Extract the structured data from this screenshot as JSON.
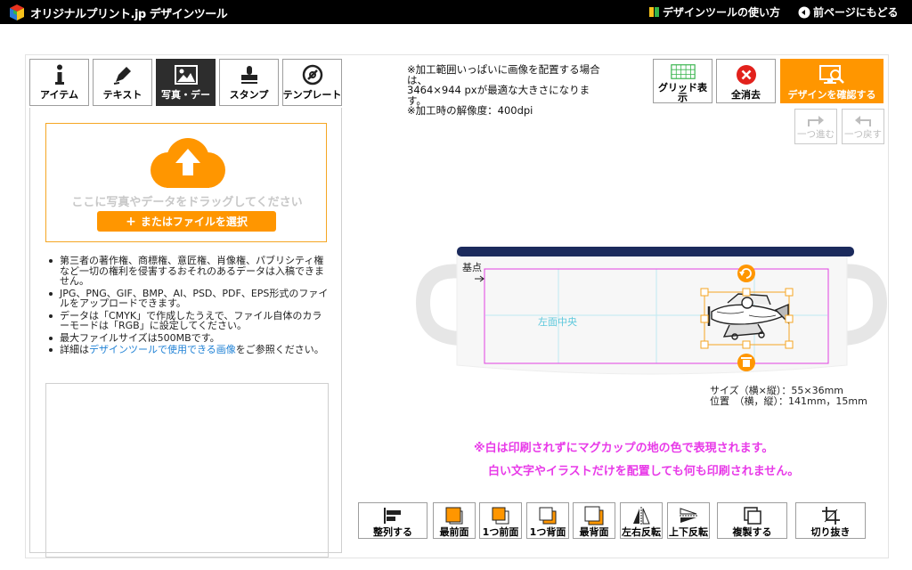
{
  "header": {
    "site_name": "オリジナルプリント.jp デザインツール",
    "help_link": "デザインツールの使い方",
    "back_link": "前ページにもどる"
  },
  "tabs": [
    {
      "label": "アイテム",
      "icon": "i-icon"
    },
    {
      "label": "テキスト",
      "icon": "pen-icon"
    },
    {
      "label": "写真・デー",
      "icon": "image-icon"
    },
    {
      "label": "スタンプ",
      "icon": "stamp-icon"
    },
    {
      "label": "テンプレート",
      "icon": "template-icon"
    }
  ],
  "upload": {
    "drop_text": "ここに写真やデータをドラッグしてください",
    "button_label": "またはファイルを選択"
  },
  "notes": {
    "n1": "第三者の著作権、商標権、意匠権、肖像権、パブリシティ権など一切の権利を侵害するおそれのあるデータは入稿できません。",
    "n2": "JPG、PNG、GIF、BMP、AI、PSD、PDF、EPS形式のファイルをアップロードできます。",
    "n3": "データは「CMYK」で作成したうえで、ファイル自体のカラーモードは「RGB」に設定してください。",
    "n4": "最大ファイルサイズは500MBです。",
    "n5_prefix": "詳細は",
    "n5_link": "デザインツールで使用できる画像",
    "n5_suffix": "をご参照ください。"
  },
  "info": {
    "line1": "※加工範囲いっぱいに画像を配置する場合は、",
    "line2": "3464×944 pxが最適な大きさになります。",
    "line3": "※加工時の解像度：400dpi"
  },
  "tools": {
    "grid": "グリッド表示",
    "clear": "全消去",
    "confirm": "デザインを確認する",
    "redo": "一つ進む",
    "undo": "一つ戻す"
  },
  "canvas": {
    "origin_label": "基点",
    "center_label": "左面中央",
    "size_text": "サイズ（横×縦）：55×36mm",
    "pos_text": "位置　（横，縦）：141mm，15mm"
  },
  "warning": {
    "line1": "※白は印刷されずにマグカップの地の色で表現されます。",
    "line2": "白い文字やイラストだけを配置しても何も印刷されません。"
  },
  "bottom_tools": {
    "align": "整列する",
    "front": "最前面",
    "forward": "1つ前面",
    "backward": "1つ背面",
    "back": "最背面",
    "flip_h": "左右反転",
    "flip_v": "上下反転",
    "duplicate": "複製する",
    "crop": "切り抜き"
  },
  "colors": {
    "accent": "#ff9600",
    "guide": "#e040e0",
    "warn": "#e83ae8",
    "rim": "#1b2a5c"
  }
}
